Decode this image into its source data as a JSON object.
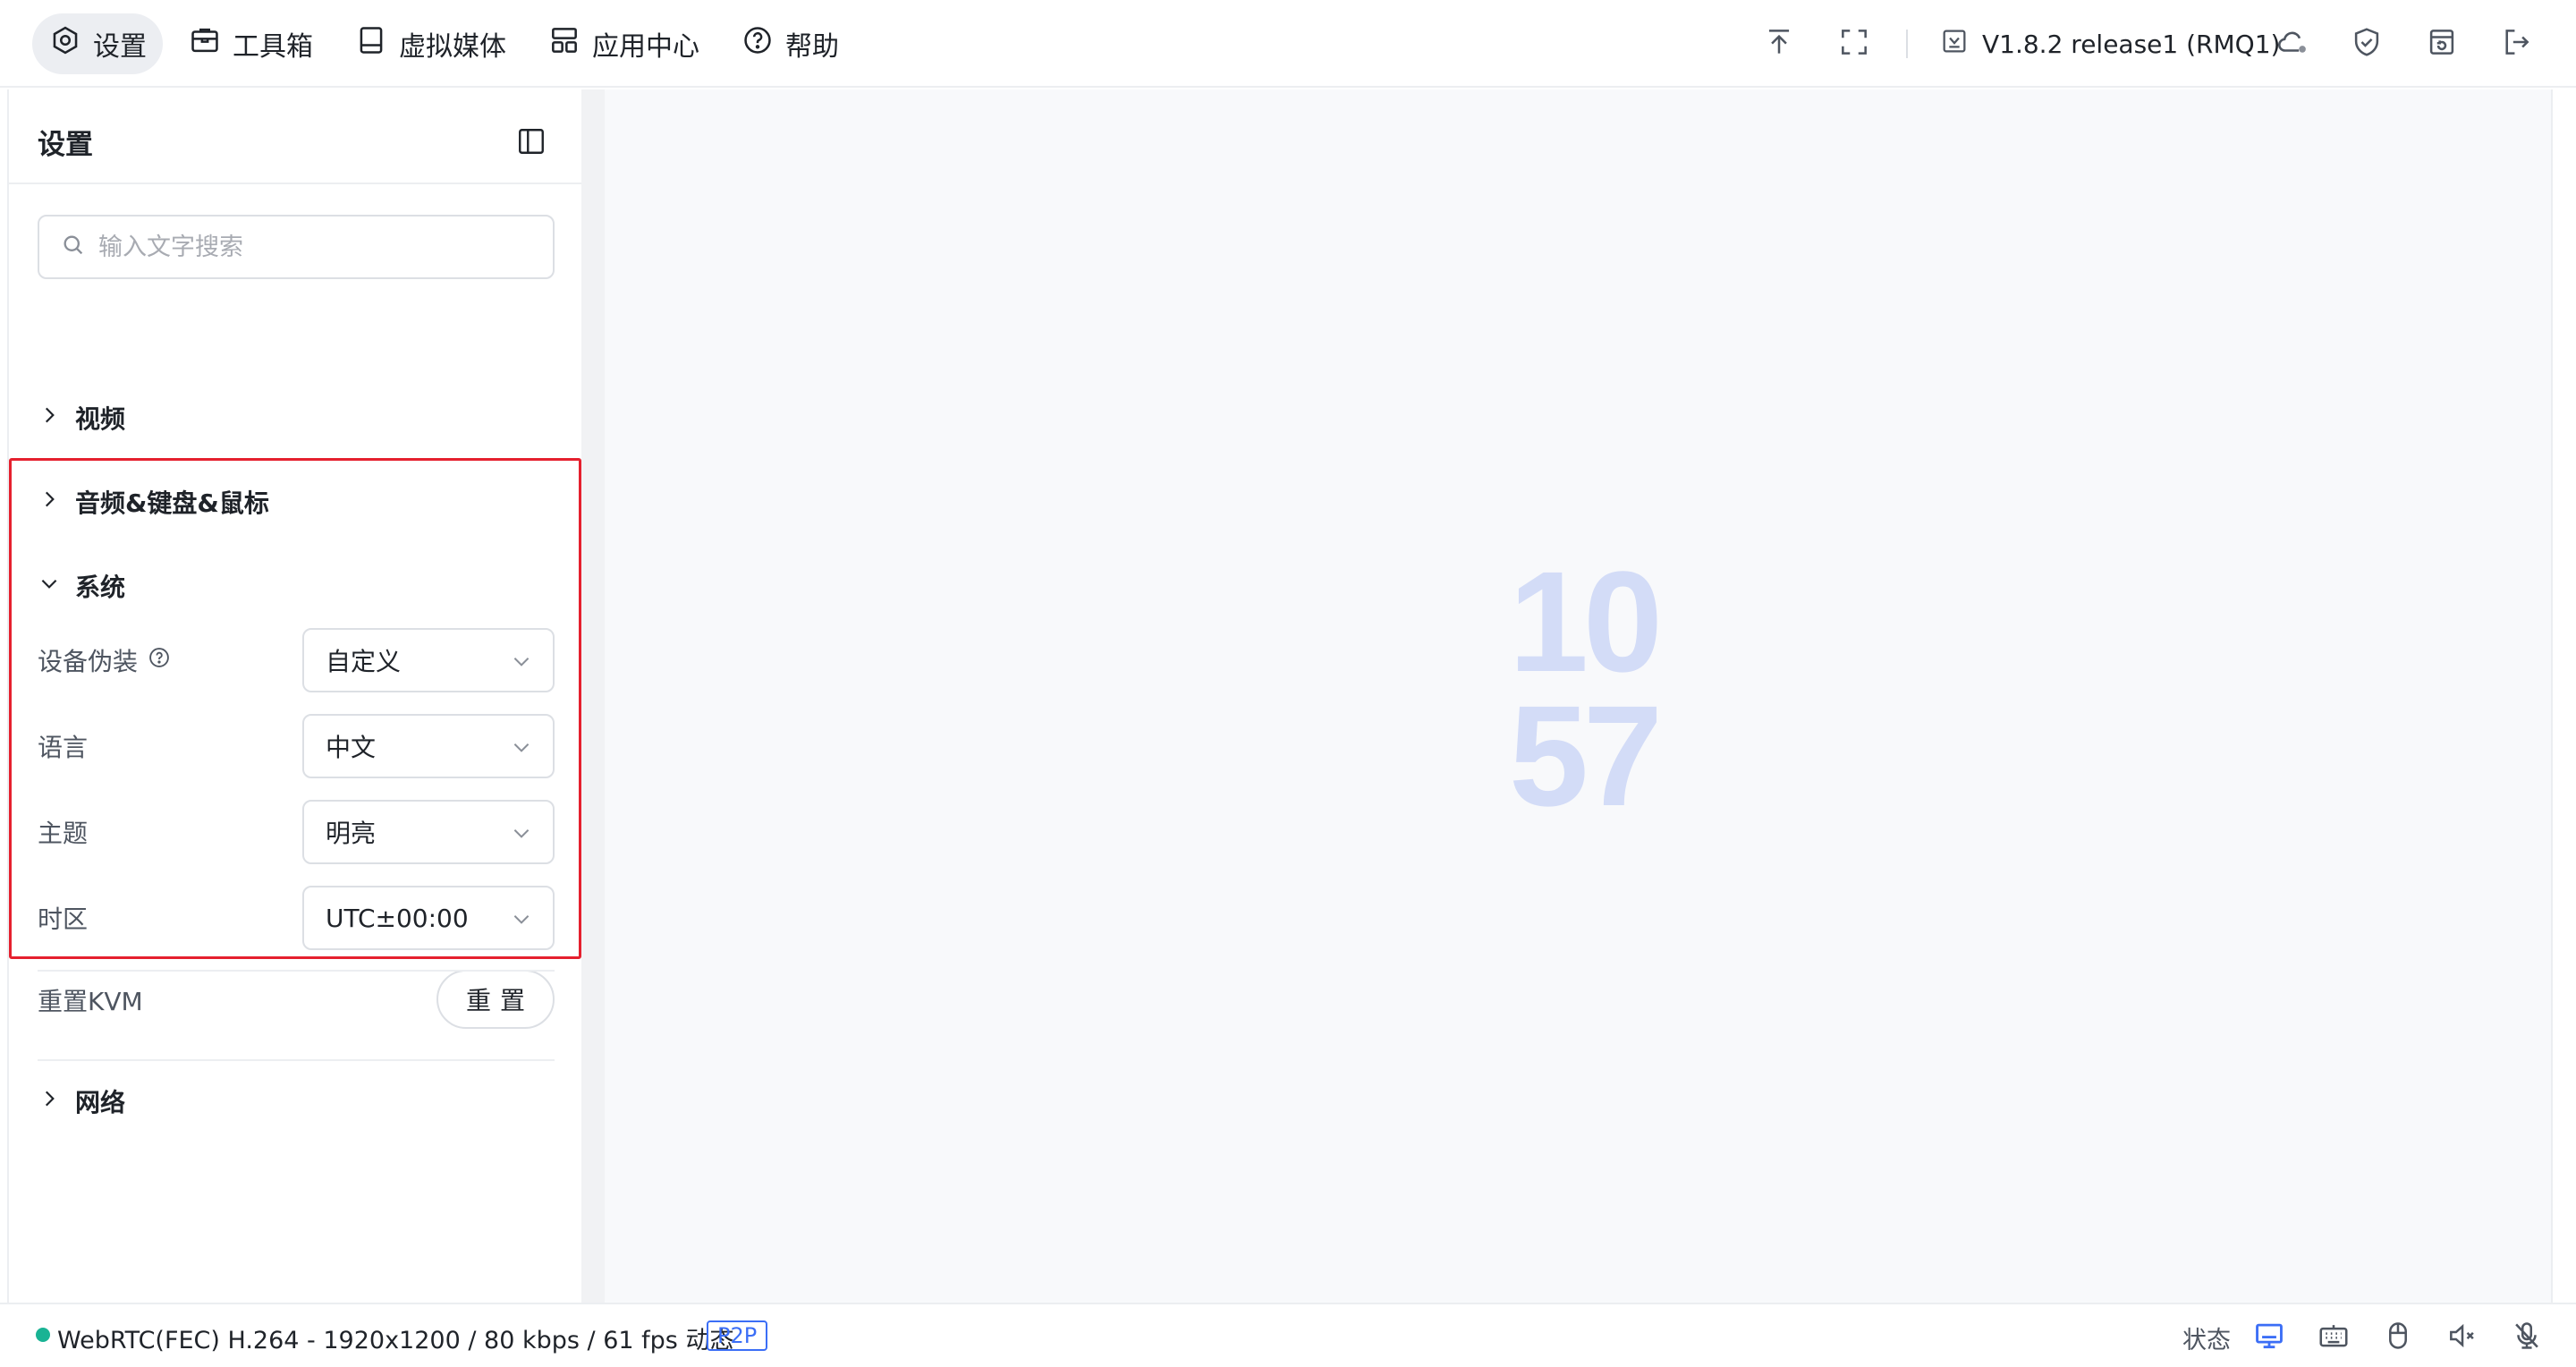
{
  "nav": [
    {
      "label": "设置",
      "icon": "gear-icon",
      "active": true
    },
    {
      "label": "工具箱",
      "icon": "toolbox-icon"
    },
    {
      "label": "虚拟媒体",
      "icon": "drive-icon"
    },
    {
      "label": "应用中心",
      "icon": "apps-grid-icon"
    },
    {
      "label": "帮助",
      "icon": "help-circle-icon"
    }
  ],
  "toolbar": {
    "version": "V1.8.2 release1 (RMQ1)",
    "icons": [
      "upload-top-icon",
      "fullscreen-icon",
      "version-check-icon",
      "cloud-icon",
      "shield-check-icon",
      "window-restore-icon",
      "logout-icon"
    ]
  },
  "sidebar": {
    "title": "设置",
    "search": {
      "placeholder": "输入文字搜索",
      "value": ""
    },
    "sections": {
      "video": "视频",
      "audio": "音频&键盘&鼠标",
      "system": "系统",
      "network": "网络"
    },
    "system": {
      "disguise": {
        "label": "设备伪装",
        "value": "自定义"
      },
      "language": {
        "label": "语言",
        "value": "中文"
      },
      "theme": {
        "label": "主题",
        "value": "明亮"
      },
      "timezone": {
        "label": "时区",
        "value": "UTC±00:00"
      },
      "reset": {
        "label": "重置KVM",
        "button": "重置"
      }
    }
  },
  "viewer": {
    "clock_hour": "10",
    "clock_minute": "57"
  },
  "statusbar": {
    "connection": "WebRTC(FEC) H.264 - 1920x1200 /  80 kbps / 61 fps 动态",
    "badge": "P2P",
    "status_label": "状态",
    "icons": [
      "monitor-icon",
      "keyboard-icon",
      "mouse-icon",
      "speaker-muted-icon",
      "microphone-muted-icon"
    ]
  },
  "colors": {
    "accent": "#3b6ef6",
    "highlight_border": "#e5202e",
    "connection_ok": "#19b394",
    "clock": "#d3dcf7"
  }
}
